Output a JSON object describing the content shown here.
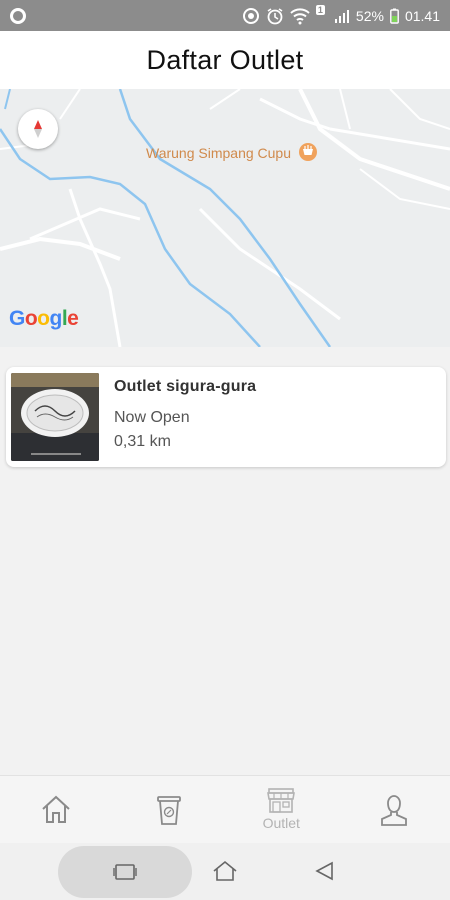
{
  "status_bar": {
    "battery": "52%",
    "time": "01.41",
    "notification_badge": "1"
  },
  "header": {
    "title": "Daftar Outlet"
  },
  "map": {
    "poi_label": "Warung Simpang Cupu",
    "attribution": "Google"
  },
  "outlets": [
    {
      "name": "Outlet sigura-gura",
      "status": "Now Open",
      "distance": "0,31 km"
    }
  ],
  "bottom_nav": {
    "outlet_label": "Outlet"
  },
  "colors": {
    "status_bar_bg": "#8c8c8c",
    "poi_orange": "#d08a4c",
    "map_river": "#8ec5ef",
    "nav_inactive": "#9a9a9a",
    "nav_active": "#b3b3b3"
  }
}
